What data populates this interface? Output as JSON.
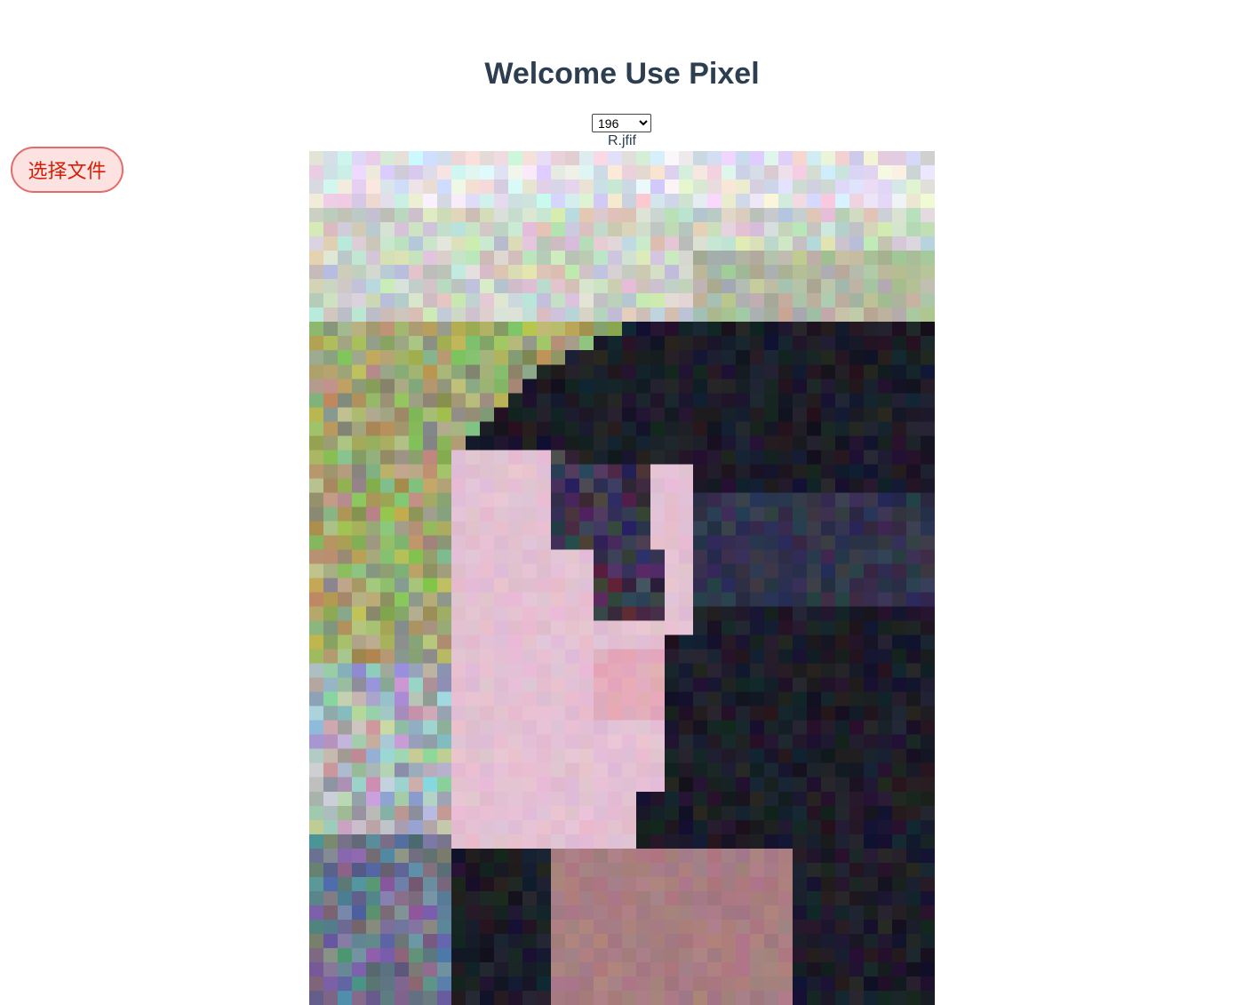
{
  "header": {
    "title": "Welcome Use Pixel"
  },
  "upload": {
    "button_label": "选择文件"
  },
  "pixel_size": {
    "selected": "196",
    "options": [
      "196"
    ]
  },
  "file": {
    "name": "R.jfif"
  },
  "colors": {
    "title": "#2c3e50",
    "button_bg": "#fde2e2",
    "button_border": "#e46b6b",
    "button_text": "#d81e06"
  }
}
